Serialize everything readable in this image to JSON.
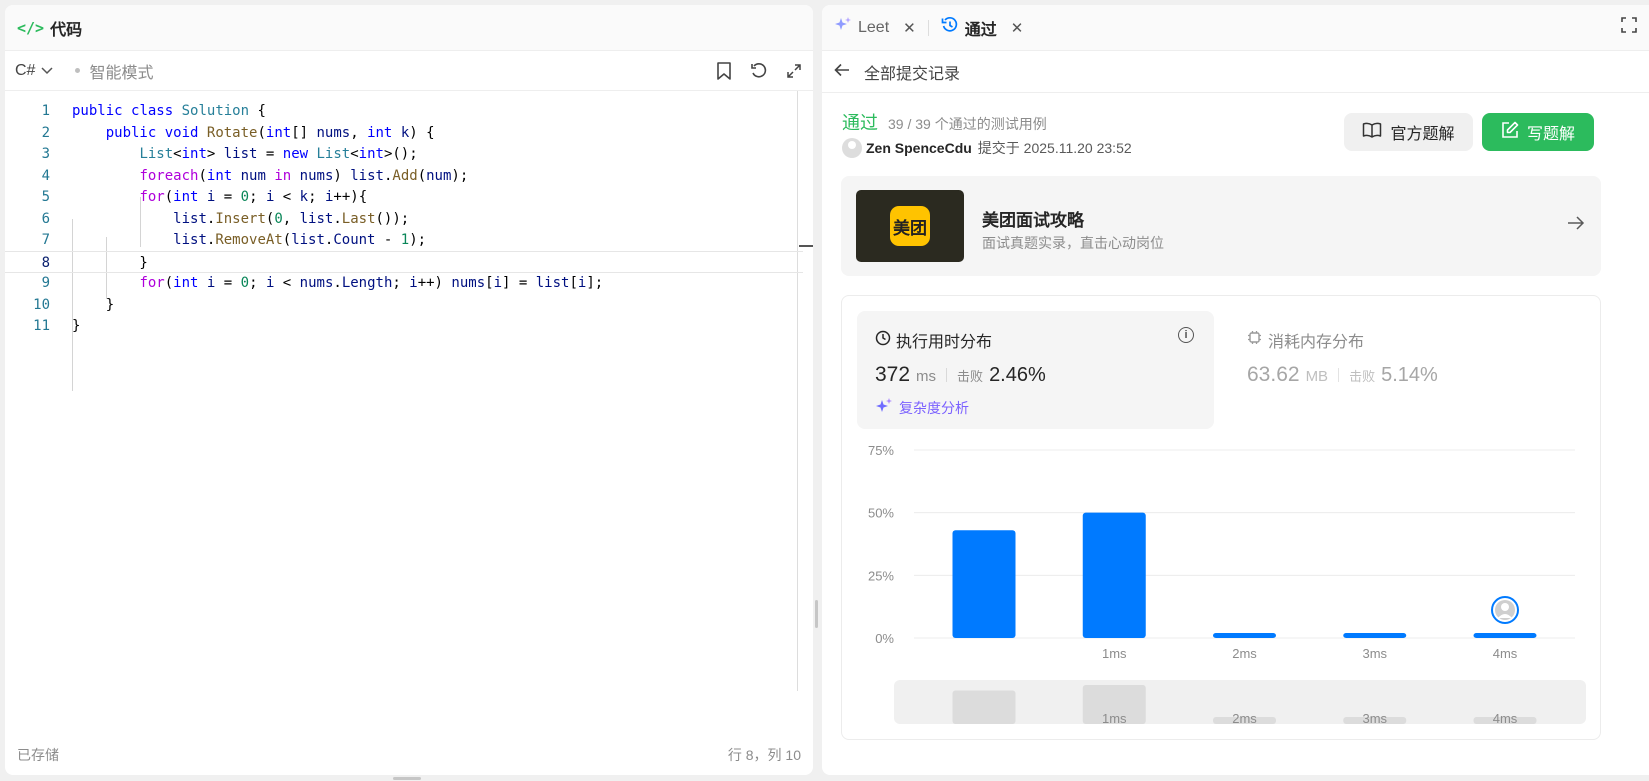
{
  "left_panel": {
    "title": "代码",
    "language": "C#",
    "mode": "智能模式",
    "saved_status": "已存储",
    "cursor_position": "行 8，列 10"
  },
  "code": {
    "active_line": 8,
    "lines": [
      [
        [
          "kw",
          "public"
        ],
        [
          "pl",
          " "
        ],
        [
          "kw",
          "class"
        ],
        [
          "pl",
          " "
        ],
        [
          "ty",
          "Solution"
        ],
        [
          "pl",
          " {"
        ]
      ],
      [
        [
          "pl",
          "    "
        ],
        [
          "kw",
          "public"
        ],
        [
          "pl",
          " "
        ],
        [
          "kw",
          "void"
        ],
        [
          "pl",
          " "
        ],
        [
          "fn",
          "Rotate"
        ],
        [
          "pl",
          "("
        ],
        [
          "kw",
          "int"
        ],
        [
          "pl",
          "[] "
        ],
        [
          "id",
          "nums"
        ],
        [
          "pl",
          ", "
        ],
        [
          "kw",
          "int"
        ],
        [
          "pl",
          " "
        ],
        [
          "id",
          "k"
        ],
        [
          "pl",
          ") {"
        ]
      ],
      [
        [
          "pl",
          "        "
        ],
        [
          "ty",
          "List"
        ],
        [
          "pl",
          "<"
        ],
        [
          "kw",
          "int"
        ],
        [
          "pl",
          "> "
        ],
        [
          "id",
          "list"
        ],
        [
          "pl",
          " = "
        ],
        [
          "kw",
          "new"
        ],
        [
          "pl",
          " "
        ],
        [
          "ty",
          "List"
        ],
        [
          "pl",
          "<"
        ],
        [
          "kw",
          "int"
        ],
        [
          "pl",
          ">();"
        ]
      ],
      [
        [
          "pl",
          "        "
        ],
        [
          "kw2",
          "foreach"
        ],
        [
          "pl",
          "("
        ],
        [
          "kw",
          "int"
        ],
        [
          "pl",
          " "
        ],
        [
          "id",
          "num"
        ],
        [
          "pl",
          " "
        ],
        [
          "kw2",
          "in"
        ],
        [
          "pl",
          " "
        ],
        [
          "id",
          "nums"
        ],
        [
          "pl",
          ") "
        ],
        [
          "id",
          "list"
        ],
        [
          "pl",
          "."
        ],
        [
          "fn",
          "Add"
        ],
        [
          "pl",
          "("
        ],
        [
          "id",
          "num"
        ],
        [
          "pl",
          ");"
        ]
      ],
      [
        [
          "pl",
          "        "
        ],
        [
          "kw2",
          "for"
        ],
        [
          "pl",
          "("
        ],
        [
          "kw",
          "int"
        ],
        [
          "pl",
          " "
        ],
        [
          "id",
          "i"
        ],
        [
          "pl",
          " = "
        ],
        [
          "num",
          "0"
        ],
        [
          "pl",
          "; "
        ],
        [
          "id",
          "i"
        ],
        [
          "pl",
          " < "
        ],
        [
          "id",
          "k"
        ],
        [
          "pl",
          "; "
        ],
        [
          "id",
          "i"
        ],
        [
          "pl",
          "++){"
        ]
      ],
      [
        [
          "pl",
          "            "
        ],
        [
          "id",
          "list"
        ],
        [
          "pl",
          "."
        ],
        [
          "fn",
          "Insert"
        ],
        [
          "pl",
          "("
        ],
        [
          "num",
          "0"
        ],
        [
          "pl",
          ", "
        ],
        [
          "id",
          "list"
        ],
        [
          "pl",
          "."
        ],
        [
          "fn",
          "Last"
        ],
        [
          "pl",
          "());"
        ]
      ],
      [
        [
          "pl",
          "            "
        ],
        [
          "id",
          "list"
        ],
        [
          "pl",
          "."
        ],
        [
          "fn",
          "RemoveAt"
        ],
        [
          "pl",
          "("
        ],
        [
          "id",
          "list"
        ],
        [
          "pl",
          "."
        ],
        [
          "id",
          "Count"
        ],
        [
          "pl",
          " - "
        ],
        [
          "num",
          "1"
        ],
        [
          "pl",
          ");"
        ]
      ],
      [
        [
          "pl",
          "        }"
        ]
      ],
      [
        [
          "pl",
          "        "
        ],
        [
          "kw2",
          "for"
        ],
        [
          "pl",
          "("
        ],
        [
          "kw",
          "int"
        ],
        [
          "pl",
          " "
        ],
        [
          "id",
          "i"
        ],
        [
          "pl",
          " = "
        ],
        [
          "num",
          "0"
        ],
        [
          "pl",
          "; "
        ],
        [
          "id",
          "i"
        ],
        [
          "pl",
          " < "
        ],
        [
          "id",
          "nums"
        ],
        [
          "pl",
          "."
        ],
        [
          "id",
          "Length"
        ],
        [
          "pl",
          "; "
        ],
        [
          "id",
          "i"
        ],
        [
          "pl",
          "++) "
        ],
        [
          "id",
          "nums"
        ],
        [
          "pl",
          "["
        ],
        [
          "id",
          "i"
        ],
        [
          "pl",
          "] = "
        ],
        [
          "id",
          "list"
        ],
        [
          "pl",
          "["
        ],
        [
          "id",
          "i"
        ],
        [
          "pl",
          "];"
        ]
      ],
      [
        [
          "pl",
          "    }"
        ]
      ],
      [
        [
          "pl",
          "}"
        ]
      ]
    ]
  },
  "right_panel": {
    "tabs": [
      {
        "label": "Leet",
        "icon": "sparkle-icon",
        "active": false
      },
      {
        "label": "通过",
        "icon": "history-icon",
        "active": true
      }
    ],
    "back_label": "全部提交记录",
    "status": "通过",
    "test_cases": "39 / 39 个通过的测试用例",
    "author": "Zen SpenceCdu",
    "submitted_at": "提交于 2025.11.20 23:52",
    "official_solution_label": "官方题解",
    "write_solution_label": "写题解"
  },
  "ad": {
    "logo_text": "美团",
    "title": "美团面试攻略",
    "subtitle": "面试真题实录，直击心动岗位"
  },
  "runtime": {
    "title": "执行用时分布",
    "value": "372",
    "unit": "ms",
    "beat_label": "击败",
    "beat_pct": "2.46%",
    "complexity_label": "复杂度分析"
  },
  "memory": {
    "title": "消耗内存分布",
    "value": "63.62",
    "unit": "MB",
    "beat_label": "击败",
    "beat_pct": "5.14%"
  },
  "colors": {
    "accent_green": "#2cbb5d",
    "bar_blue": "#007aff",
    "complexity_purple": "#7b61ff"
  },
  "chart_data": {
    "type": "bar",
    "categories": [
      "",
      "1ms",
      "2ms",
      "3ms",
      "4ms"
    ],
    "values": [
      43,
      50,
      2,
      2,
      2
    ],
    "ylim": [
      0,
      75
    ],
    "yticks": [
      "0%",
      "25%",
      "50%",
      "75%"
    ],
    "y_tick_values": [
      0,
      25,
      50,
      75
    ],
    "grid": true,
    "user_marker_category": "4ms",
    "overview_categories": [
      "",
      "1ms",
      "2ms",
      "3ms",
      "4ms"
    ]
  }
}
